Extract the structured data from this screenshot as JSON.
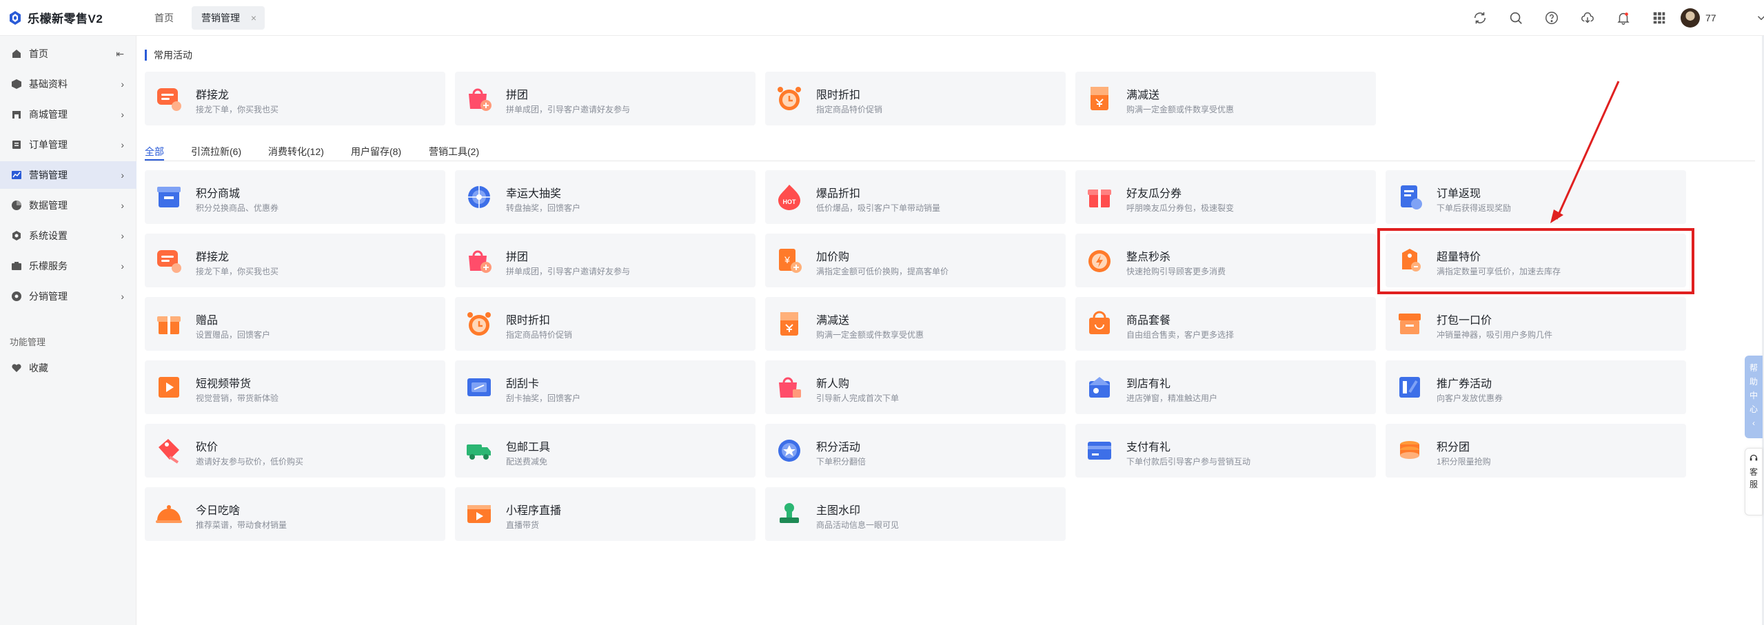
{
  "app": {
    "title": "乐檬新零售V2"
  },
  "tabs": {
    "home": "首页",
    "active": "营销管理",
    "close": "×"
  },
  "user": {
    "name": "77"
  },
  "sidebar": {
    "items": [
      {
        "label": "首页",
        "icon": "home-icon",
        "chev": "⇤"
      },
      {
        "label": "基础资料",
        "icon": "box-icon",
        "chev": "›"
      },
      {
        "label": "商城管理",
        "icon": "store-icon",
        "chev": "›"
      },
      {
        "label": "订单管理",
        "icon": "order-icon",
        "chev": "›"
      },
      {
        "label": "营销管理",
        "icon": "chart-icon",
        "chev": "›"
      },
      {
        "label": "数据管理",
        "icon": "pie-icon",
        "chev": "›"
      },
      {
        "label": "系统设置",
        "icon": "gear-icon",
        "chev": "›"
      },
      {
        "label": "乐檬服务",
        "icon": "service-icon",
        "chev": "›"
      },
      {
        "label": "分销管理",
        "icon": "share-icon",
        "chev": "›"
      }
    ],
    "section": "功能管理",
    "favorites": "收藏"
  },
  "main": {
    "section_title": "常用活动",
    "common": [
      {
        "title": "群接龙",
        "desc": "接龙下单，你买我也买",
        "icon": "chat-icon"
      },
      {
        "title": "拼团",
        "desc": "拼单成团，引导客户邀请好友参与",
        "icon": "bag-icon"
      },
      {
        "title": "限时折扣",
        "desc": "指定商品特价促销",
        "icon": "clock-icon"
      },
      {
        "title": "满减送",
        "desc": "购满一定金额或件数享受优惠",
        "icon": "voucher-icon"
      }
    ],
    "filters": [
      "全部",
      "引流拉新(6)",
      "消费转化(12)",
      "用户留存(8)",
      "营销工具(2)"
    ],
    "cards": [
      {
        "title": "积分商城",
        "desc": "积分兑换商品、优惠券",
        "icon": "points-store-icon"
      },
      {
        "title": "幸运大抽奖",
        "desc": "转盘抽奖，回馈客户",
        "icon": "wheel-icon"
      },
      {
        "title": "爆品折扣",
        "desc": "低价爆品，吸引客户下单带动销量",
        "icon": "hot-icon",
        "badge": "HOT"
      },
      {
        "title": "好友瓜分券",
        "desc": "呼朋唤友瓜分券包，极速裂变",
        "icon": "gift-icon"
      },
      {
        "title": "订单返现",
        "desc": "下单后获得返现奖励",
        "icon": "cashback-icon"
      },
      {
        "title": "群接龙",
        "desc": "接龙下单，你买我也买",
        "icon": "chat-icon"
      },
      {
        "title": "拼团",
        "desc": "拼单成团，引导客户邀请好友参与",
        "icon": "bag-icon"
      },
      {
        "title": "加价购",
        "desc": "满指定金额可低价换购，提高客单价",
        "icon": "addon-icon"
      },
      {
        "title": "整点秒杀",
        "desc": "快速抢购引导顾客更多消费",
        "icon": "flash-icon"
      },
      {
        "title": "超量特价",
        "desc": "满指定数量可享低价，加速去库存",
        "icon": "price-tag-icon"
      },
      {
        "title": "赠品",
        "desc": "设置赠品，回馈客户",
        "icon": "present-icon"
      },
      {
        "title": "限时折扣",
        "desc": "指定商品特价促销",
        "icon": "clock-icon"
      },
      {
        "title": "满减送",
        "desc": "购满一定金额或件数享受优惠",
        "icon": "voucher-icon"
      },
      {
        "title": "商品套餐",
        "desc": "自由组合售卖，客户更多选择",
        "icon": "package-icon"
      },
      {
        "title": "打包一口价",
        "desc": "冲销量神器，吸引用户多购几件",
        "icon": "bundle-icon"
      },
      {
        "title": "短视频带货",
        "desc": "视觉营销，带货新体验",
        "icon": "video-icon"
      },
      {
        "title": "刮刮卡",
        "desc": "刮卡抽奖，回馈客户",
        "icon": "scratch-icon"
      },
      {
        "title": "新人购",
        "desc": "引导新人完成首次下单",
        "icon": "newcomer-icon"
      },
      {
        "title": "到店有礼",
        "desc": "进店弹窗，精准触达用户",
        "icon": "visit-gift-icon"
      },
      {
        "title": "推广券活动",
        "desc": "向客户发放优惠券",
        "icon": "promo-coupon-icon"
      },
      {
        "title": "砍价",
        "desc": "邀请好友参与砍价，低价购买",
        "icon": "bargain-icon"
      },
      {
        "title": "包邮工具",
        "desc": "配送费减免",
        "icon": "truck-icon"
      },
      {
        "title": "积分活动",
        "desc": "下单积分翻倍",
        "icon": "points-icon"
      },
      {
        "title": "支付有礼",
        "desc": "下单付款后引导客户参与营销互动",
        "icon": "card-icon"
      },
      {
        "title": "积分团",
        "desc": "1积分限量抢购",
        "icon": "coins-icon"
      },
      {
        "title": "今日吃啥",
        "desc": "推荐菜谱，带动食材销量",
        "icon": "dish-icon"
      },
      {
        "title": "小程序直播",
        "desc": "直播带货",
        "icon": "live-icon"
      },
      {
        "title": "主图水印",
        "desc": "商品活动信息一眼可见",
        "icon": "stamp-icon"
      }
    ]
  },
  "right_tabs": {
    "help": [
      "帮",
      "助",
      "中",
      "心",
      "‹"
    ],
    "service": [
      "客",
      "服"
    ]
  },
  "colors": {
    "accent": "#2a5bd7",
    "orange": "#ff7a2a",
    "red": "#ff5a3c",
    "blue": "#3d6fe8",
    "green": "#2bb673",
    "highlight": "#e02020"
  }
}
